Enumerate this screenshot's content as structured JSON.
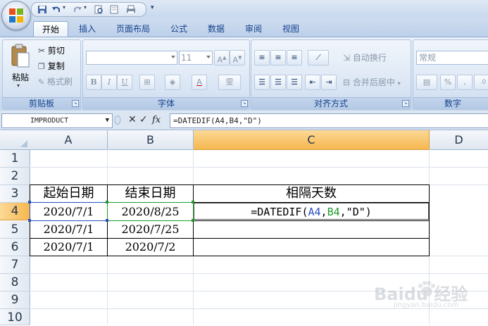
{
  "quick_access": {
    "icons": [
      "save-icon",
      "undo-icon",
      "redo-icon",
      "print-preview-icon",
      "quick-print-icon",
      "customize-qat-icon"
    ]
  },
  "tabs": [
    "开始",
    "插入",
    "页面布局",
    "公式",
    "数据",
    "审阅",
    "视图"
  ],
  "active_tab": "开始",
  "ribbon": {
    "clipboard": {
      "label": "剪贴板",
      "paste": "粘贴",
      "cut": "剪切",
      "copy": "复制",
      "format_painter": "格式刷"
    },
    "font": {
      "label": "字体",
      "font_name": "",
      "font_size": "11",
      "bold": "B",
      "italic": "I",
      "underline": "U",
      "font_color": "A",
      "phonetic": "雯"
    },
    "alignment": {
      "label": "对齐方式",
      "wrap_text": "自动换行",
      "merge_center": "合并后居中"
    },
    "number": {
      "label": "数字",
      "format": "常规",
      "percent": "%",
      "comma": ","
    }
  },
  "formula_bar": {
    "name_box": "IMPRODUCT",
    "fx": "fx",
    "formula": "=DATEDIF(A4,B4,\"D\")"
  },
  "columns": [
    "A",
    "B",
    "C",
    "D"
  ],
  "selected_column": "C",
  "rows": [
    "1",
    "2",
    "3",
    "4",
    "5",
    "6",
    "7",
    "8",
    "9",
    "10"
  ],
  "selected_row": "4",
  "cells": {
    "header": [
      "起始日期",
      "结束日期",
      "相隔天数"
    ],
    "data": [
      [
        "2020/7/1",
        "2020/8/25"
      ],
      [
        "2020/7/1",
        "2020/7/25"
      ],
      [
        "2020/7/1",
        "2020/7/2"
      ]
    ],
    "editing_formula": {
      "prefix": "=DATEDIF(",
      "ref1": "A4",
      "sep1": ",",
      "ref2": "B4",
      "sep2": ",",
      "tail": "\"D\")"
    }
  },
  "colors": {
    "ref1": "#2a4fbf",
    "ref2": "#1f9b2c",
    "selected_header": "#f6b74f",
    "ribbon_text": "#15428b"
  },
  "watermark": {
    "brand": "Baidu 经验",
    "url": "jingyan.baidu.com"
  }
}
